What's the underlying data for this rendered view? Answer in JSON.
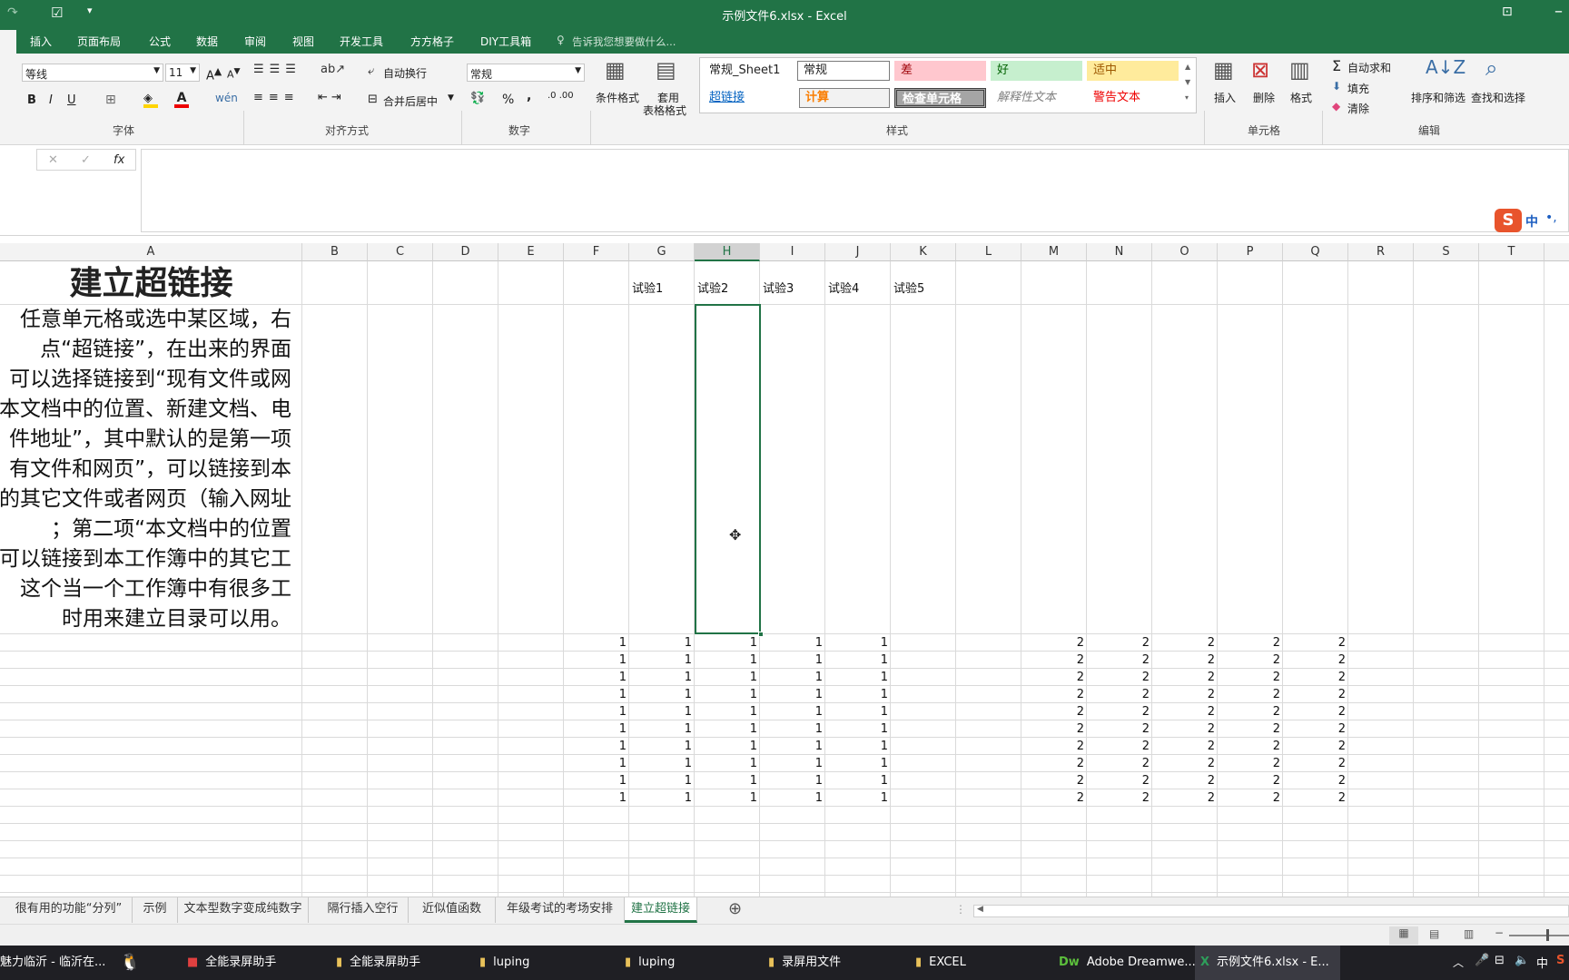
{
  "titlebar": {
    "title": "示例文件6.xlsx - Excel"
  },
  "ribbon_tabs": [
    "插入",
    "页面布局",
    "公式",
    "数据",
    "审阅",
    "视图",
    "开发工具",
    "方方格子",
    "DIY工具箱"
  ],
  "tell_me": "告诉我您想要做什么...",
  "font": {
    "name": "等线",
    "size": "11",
    "bold": "B",
    "italic": "I",
    "underline": "U",
    "group": "字体"
  },
  "align": {
    "wrap": "自动换行",
    "merge": "合并后居中",
    "group": "对齐方式"
  },
  "number": {
    "format": "常规",
    "percent": "%",
    "comma": ",",
    "group": "数字"
  },
  "styles": {
    "cond": "条件格式",
    "table1": "套用",
    "table2": "表格格式",
    "normal_sheet": "常规_Sheet1",
    "normal": "常规",
    "bad": "差",
    "good": "好",
    "neutral": "适中",
    "hyperlink": "超链接",
    "calc": "计算",
    "check": "检查单元格",
    "explain": "解释性文本",
    "warn": "警告文本",
    "group": "样式"
  },
  "cells_group": {
    "insert": "插入",
    "delete": "删除",
    "format": "格式",
    "group": "单元格"
  },
  "edit_group": {
    "autosum": "自动求和",
    "fill": "填充",
    "clear": "清除",
    "sort": "排序和筛选",
    "find": "查找和选择",
    "group": "编辑"
  },
  "formula": {
    "fx": "fx",
    "value": ""
  },
  "ime": {
    "label": "中"
  },
  "columns": [
    "A",
    "B",
    "C",
    "D",
    "E",
    "F",
    "G",
    "H",
    "I",
    "J",
    "K",
    "L",
    "M",
    "N",
    "O",
    "P",
    "Q",
    "R",
    "S",
    "T"
  ],
  "sheet": {
    "title": "建立超链接",
    "text_lines": [
      "任意单元格或选中某区域，右",
      "点“超链接”，在出来的界面",
      "可以选择链接到“现有文件或网",
      "本文档中的位置、新建文档、电",
      "件地址”，其中默认的是第一项",
      "有文件和网页”，可以链接到本",
      "的其它文件或者网页（输入网址",
      "；第二项“本文档中的位置",
      "可以链接到本工作簿中的其它工",
      "这个当一个工作簿中有很多工",
      "时用来建立目录可以用。"
    ],
    "headers": [
      "试验1",
      "试验2",
      "试验3",
      "试验4",
      "试验5"
    ],
    "left_values": [
      "1",
      "1",
      "1",
      "1",
      "1"
    ],
    "right_values": [
      "2",
      "2",
      "2",
      "2",
      "2"
    ]
  },
  "sheet_tabs": [
    "很有用的功能“分列”",
    "示例",
    "文本型数字变成纯数字",
    "隔行插入空行",
    "近似值函数",
    "年级考试的考场安排",
    "建立超链接"
  ],
  "taskbar": [
    "魅力临沂 - 临沂在...",
    "全能录屏助手",
    "全能录屏助手",
    "luping",
    "luping",
    "录屏用文件",
    "EXCEL",
    "Adobe Dreamwe...",
    "示例文件6.xlsx - E..."
  ],
  "tray": {
    "ime": "中"
  },
  "colors": {
    "excel_green": "#217346",
    "selection": "#217346"
  }
}
